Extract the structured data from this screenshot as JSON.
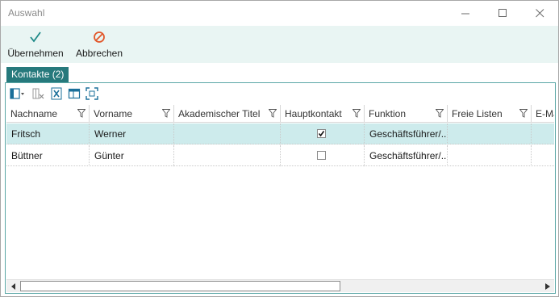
{
  "window": {
    "title": "Auswahl"
  },
  "ribbon": {
    "apply_label": "Übernehmen",
    "cancel_label": "Abbrechen",
    "colors": {
      "apply": "#1f8a88",
      "cancel": "#e2572a"
    }
  },
  "tab": {
    "label": "Kontakte (2)"
  },
  "grid": {
    "columns": [
      "Nachname",
      "Vorname",
      "Akademischer Titel",
      "Hauptkontakt",
      "Funktion",
      "Freie Listen",
      "E-Mail"
    ],
    "rows": [
      {
        "nachname": "Fritsch",
        "vorname": "Werner",
        "titel": "",
        "hauptkontakt": true,
        "funktion": "Geschäftsführer/...",
        "freie_listen": "",
        "selected": true
      },
      {
        "nachname": "Büttner",
        "vorname": "Günter",
        "titel": "",
        "hauptkontakt": false,
        "funktion": "Geschäftsführer/...",
        "freie_listen": "",
        "selected": false
      }
    ]
  },
  "colors": {
    "accent": "#26797c",
    "selected_row": "#cdebec",
    "ribbon_bg": "#e9f5f3"
  }
}
